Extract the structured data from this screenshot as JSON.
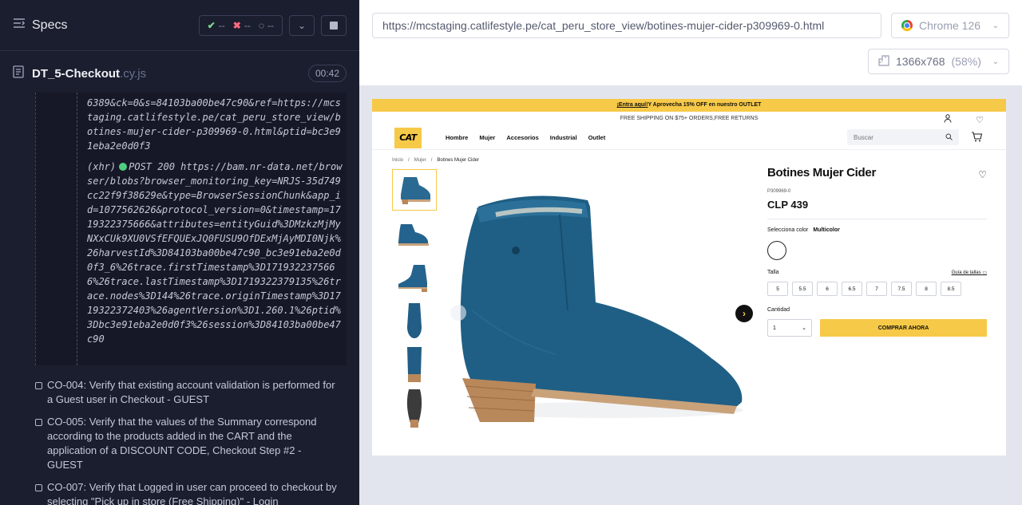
{
  "reporter": {
    "specs_label": "Specs",
    "stats": {
      "passed": "--",
      "failed": "--",
      "pending": "--"
    },
    "file_name": "DT_5-Checkout",
    "file_ext": ".cy.js",
    "duration": "00:42",
    "command_log": {
      "entry1_text": "6389&ck=0&s=84103ba00be47c90&ref=https://mcstaging.catlifestyle.pe/cat_peru_store_view/botines-mujer-cider-p309969-0.html&ptid=bc3e91eba2e0d0f3",
      "entry2_prefix": "(xhr)",
      "entry2_method": "POST 200",
      "entry2_url": "https://bam.nr-data.net/browser/blobs?browser_monitoring_key=NRJS-35d749cc22f9f38629e&type=BrowserSessionChunk&app_id=1077562626&protocol_version=0&timestamp=1719322375666&attributes=entityGuid%3DMzkzMjMyNXxCUk9XU0VSfEFQUExJQ0FUSU9OfDExMjAyMDI0Njk%26harvestId%3D84103ba00be47c90_bc3e91eba2e0d0f3_6%26trace.firstTimestamp%3D1719322375666%26trace.lastTimestamp%3D1719322379135%26trace.nodes%3D144%26trace.originTimestamp%3D1719322372403%26agentVersion%3D1.260.1%26ptid%3Dbc3e91eba2e0d0f3%26session%3D84103ba00be47c90"
    },
    "tests": [
      "CO-004: Verify that existing account validation is performed for a Guest user in Checkout - GUEST",
      "CO-005: Verify that the values of the Summary correspond according to the products added in the CART and the application of a DISCOUNT CODE, Checkout Step #2 - GUEST",
      "CO-007: Verify that Logged in user can proceed to checkout by selecting \"Pick up in store (Free Shipping)\" - Login"
    ]
  },
  "aut": {
    "url": "https://mcstaging.catlifestyle.pe/cat_peru_store_view/botines-mujer-cider-p309969-0.html",
    "browser": "Chrome 126",
    "viewport": "1366x768",
    "scale": "(58%)"
  },
  "store": {
    "promo_link": "¡Entra aquí!",
    "promo_text": "Y Aprovecha 15% OFF en nuestro OUTLET",
    "shipping_text": "FREE SHIPPING ON $75+ ORDERS,FREE RETURNS",
    "logo": "CAT",
    "nav": [
      "Hombre",
      "Mujer",
      "Accesorios",
      "Industrial",
      "Outlet"
    ],
    "search_placeholder": "Buscar",
    "breadcrumbs": [
      "Inicio",
      "/",
      "Mujer",
      "/",
      "Botines Mujer Cider"
    ],
    "product": {
      "name": "Botines Mujer Cider",
      "sku": "P309969-0",
      "price": "CLP 439",
      "color_label": "Selecciona color",
      "color_value": "Multicolor",
      "size_label": "Talla",
      "size_guide": "Guía de tallas",
      "sizes": [
        "5",
        "5.5",
        "6",
        "6.5",
        "7",
        "7.5",
        "8",
        "8.5"
      ],
      "qty_label": "Cantidad",
      "qty_value": "1",
      "buy_label": "COMPRAR AHORA"
    },
    "colors": {
      "brand_yellow": "#f7c948",
      "boot_blue": "#1f5f85",
      "heel_wood": "#b8875a"
    }
  }
}
